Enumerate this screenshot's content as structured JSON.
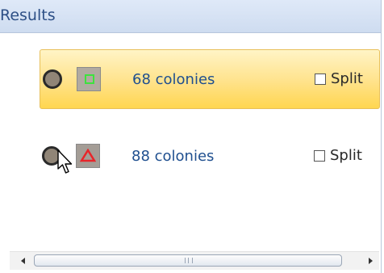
{
  "header": {
    "title": "Results"
  },
  "results": [
    {
      "label": "68 colonies",
      "split_label": "Split",
      "split_checked": false,
      "selected": true,
      "thumbnail_icon": "green-square-icon"
    },
    {
      "label": "88 colonies",
      "split_label": "Split",
      "split_checked": false,
      "selected": false,
      "thumbnail_icon": "red-triangle-icon"
    }
  ],
  "colors": {
    "selection_highlight": "#ffe28a",
    "link_text": "#1f4f8f",
    "header_text": "#2d4f86",
    "marker_green": "#3ee23e",
    "marker_red": "#e8252a"
  },
  "icons": {
    "status": "circle-icon",
    "cursor": "mouse-pointer-icon",
    "scroll_left": "chevron-left-icon",
    "scroll_right": "chevron-right-icon"
  }
}
